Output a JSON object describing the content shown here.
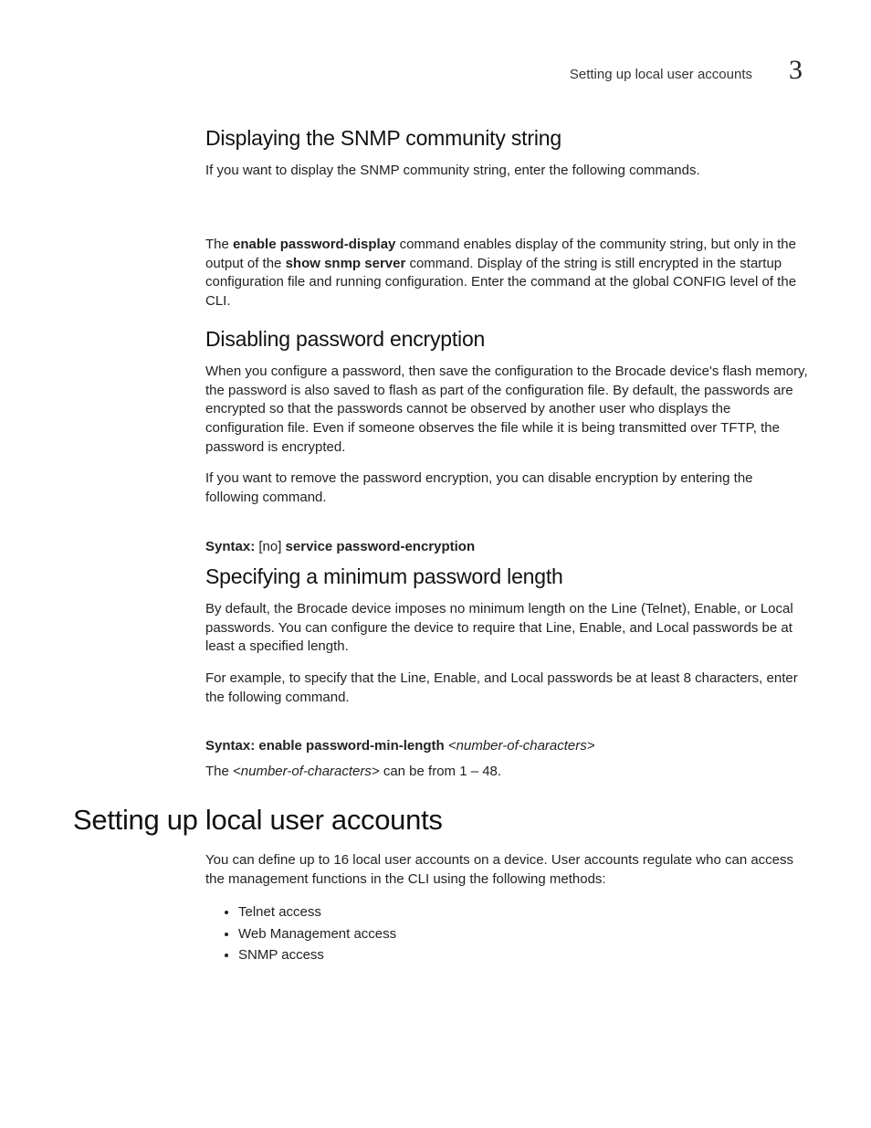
{
  "header": {
    "running_title": "Setting up local user accounts",
    "chapter_number": "3"
  },
  "sec1": {
    "heading": "Displaying the SNMP community string",
    "p1": "If you want to display the SNMP community string, enter the following commands.",
    "p2_a": "The ",
    "p2_cmd1": "enable password-display",
    "p2_b": " command enables display of the community string, but only in the output of the ",
    "p2_cmd2": "show snmp server",
    "p2_c": " command.  Display of the string is still encrypted in the startup configuration file and running configuration.  Enter the command at the global CONFIG level of the CLI."
  },
  "sec2": {
    "heading": "Disabling password encryption",
    "p1": "When you configure a password, then save the configuration to the Brocade device's flash memory, the password is also saved to flash as part of the configuration file. By default, the passwords are encrypted so that the passwords cannot be observed by another user who displays the configuration file. Even if someone observes the file while it is being transmitted over TFTP, the password is encrypted.",
    "p2": "If you want to remove the password encryption, you can disable encryption by entering the following command.",
    "syntax_label": "Syntax:  ",
    "syntax_opt": "[no] ",
    "syntax_cmd": "service password-encryption"
  },
  "sec3": {
    "heading": "Specifying a minimum password length",
    "p1": "By default, the Brocade device imposes no minimum length on the Line (Telnet), Enable, or Local passwords. You can configure the device to require that Line, Enable, and Local passwords be at least a specified length.",
    "p2": "For example, to specify that the Line, Enable, and Local passwords be at least 8 characters, enter the following command.",
    "syntax_label": "Syntax:  ",
    "syntax_cmd": "enable password-min-length ",
    "syntax_var": "<number-of-characters>",
    "note_a": "The ",
    "note_var": "<number-of-characters>",
    "note_b": " can be from 1 – 48."
  },
  "sec4": {
    "heading": "Setting up local user accounts",
    "p1": "You can define up to 16 local user accounts on a device. User accounts regulate who can access the management functions in the CLI using the following methods:",
    "bullets": {
      "b1": "Telnet access",
      "b2": "Web Management access",
      "b3": "SNMP access"
    }
  }
}
